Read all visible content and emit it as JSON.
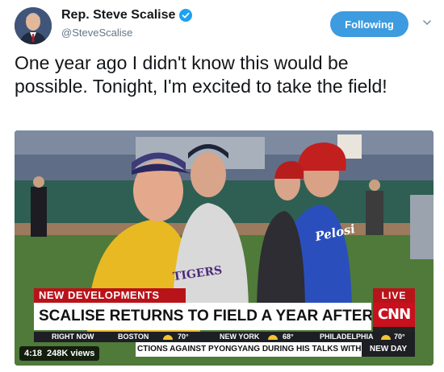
{
  "tweet": {
    "display_name": "Rep. Steve Scalise",
    "handle": "@SteveScalise",
    "follow_label": "Following",
    "text": "One year ago I didn't know this would be possible. Tonight, I'm excited to take the field!"
  },
  "video": {
    "banner_tag": "NEW DEVELOPMENTS",
    "live_label": "LIVE",
    "headline": "SCALISE RETURNS TO FIELD A YEAR AFTER SHOOTING",
    "network_logo": "CNN",
    "weather": [
      {
        "label": "RIGHT NOW",
        "temp": ""
      },
      {
        "label": "BOSTON",
        "temp": "70°"
      },
      {
        "label": "NEW YORK",
        "temp": "68°"
      },
      {
        "label": "PHILADELPHIA",
        "temp": "70°"
      }
    ],
    "ticker": "CTIONS AGAINST PYONGYANG DURING HIS TALKS WITH KIM",
    "show_name": "NEW DAY",
    "duration": "4:18",
    "views": "248K views",
    "jersey_text": "Pelosi",
    "jersey_tigers": "TIGERS"
  },
  "colors": {
    "follow_blue": "#3d9be0",
    "cnn_red": "#c8101e",
    "banner_red": "#b9131a"
  },
  "icons": {
    "verified": "verified-badge-icon",
    "chevron": "chevron-down-icon"
  }
}
